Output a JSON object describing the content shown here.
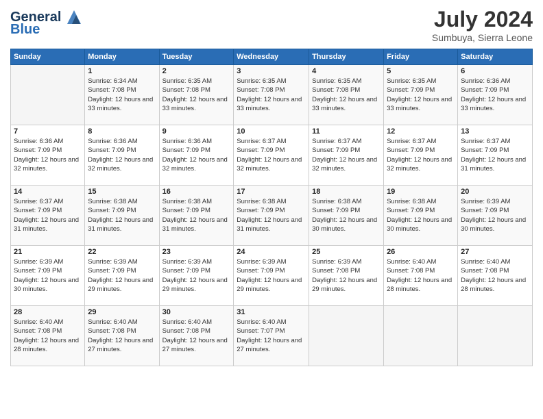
{
  "header": {
    "logo_general": "General",
    "logo_blue": "Blue",
    "month_year": "July 2024",
    "location": "Sumbuya, Sierra Leone"
  },
  "days_of_week": [
    "Sunday",
    "Monday",
    "Tuesday",
    "Wednesday",
    "Thursday",
    "Friday",
    "Saturday"
  ],
  "weeks": [
    [
      {
        "day": "",
        "info": ""
      },
      {
        "day": "1",
        "info": "Sunrise: 6:34 AM\nSunset: 7:08 PM\nDaylight: 12 hours\nand 33 minutes."
      },
      {
        "day": "2",
        "info": "Sunrise: 6:35 AM\nSunset: 7:08 PM\nDaylight: 12 hours\nand 33 minutes."
      },
      {
        "day": "3",
        "info": "Sunrise: 6:35 AM\nSunset: 7:08 PM\nDaylight: 12 hours\nand 33 minutes."
      },
      {
        "day": "4",
        "info": "Sunrise: 6:35 AM\nSunset: 7:08 PM\nDaylight: 12 hours\nand 33 minutes."
      },
      {
        "day": "5",
        "info": "Sunrise: 6:35 AM\nSunset: 7:09 PM\nDaylight: 12 hours\nand 33 minutes."
      },
      {
        "day": "6",
        "info": "Sunrise: 6:36 AM\nSunset: 7:09 PM\nDaylight: 12 hours\nand 33 minutes."
      }
    ],
    [
      {
        "day": "7",
        "info": ""
      },
      {
        "day": "8",
        "info": "Sunrise: 6:36 AM\nSunset: 7:09 PM\nDaylight: 12 hours\nand 32 minutes."
      },
      {
        "day": "9",
        "info": "Sunrise: 6:36 AM\nSunset: 7:09 PM\nDaylight: 12 hours\nand 32 minutes."
      },
      {
        "day": "10",
        "info": "Sunrise: 6:37 AM\nSunset: 7:09 PM\nDaylight: 12 hours\nand 32 minutes."
      },
      {
        "day": "11",
        "info": "Sunrise: 6:37 AM\nSunset: 7:09 PM\nDaylight: 12 hours\nand 32 minutes."
      },
      {
        "day": "12",
        "info": "Sunrise: 6:37 AM\nSunset: 7:09 PM\nDaylight: 12 hours\nand 32 minutes."
      },
      {
        "day": "13",
        "info": "Sunrise: 6:37 AM\nSunset: 7:09 PM\nDaylight: 12 hours\nand 31 minutes."
      }
    ],
    [
      {
        "day": "14",
        "info": ""
      },
      {
        "day": "15",
        "info": "Sunrise: 6:38 AM\nSunset: 7:09 PM\nDaylight: 12 hours\nand 31 minutes."
      },
      {
        "day": "16",
        "info": "Sunrise: 6:38 AM\nSunset: 7:09 PM\nDaylight: 12 hours\nand 31 minutes."
      },
      {
        "day": "17",
        "info": "Sunrise: 6:38 AM\nSunset: 7:09 PM\nDaylight: 12 hours\nand 31 minutes."
      },
      {
        "day": "18",
        "info": "Sunrise: 6:38 AM\nSunset: 7:09 PM\nDaylight: 12 hours\nand 30 minutes."
      },
      {
        "day": "19",
        "info": "Sunrise: 6:38 AM\nSunset: 7:09 PM\nDaylight: 12 hours\nand 30 minutes."
      },
      {
        "day": "20",
        "info": "Sunrise: 6:39 AM\nSunset: 7:09 PM\nDaylight: 12 hours\nand 30 minutes."
      }
    ],
    [
      {
        "day": "21",
        "info": ""
      },
      {
        "day": "22",
        "info": "Sunrise: 6:39 AM\nSunset: 7:09 PM\nDaylight: 12 hours\nand 29 minutes."
      },
      {
        "day": "23",
        "info": "Sunrise: 6:39 AM\nSunset: 7:09 PM\nDaylight: 12 hours\nand 29 minutes."
      },
      {
        "day": "24",
        "info": "Sunrise: 6:39 AM\nSunset: 7:09 PM\nDaylight: 12 hours\nand 29 minutes."
      },
      {
        "day": "25",
        "info": "Sunrise: 6:39 AM\nSunset: 7:08 PM\nDaylight: 12 hours\nand 29 minutes."
      },
      {
        "day": "26",
        "info": "Sunrise: 6:40 AM\nSunset: 7:08 PM\nDaylight: 12 hours\nand 28 minutes."
      },
      {
        "day": "27",
        "info": "Sunrise: 6:40 AM\nSunset: 7:08 PM\nDaylight: 12 hours\nand 28 minutes."
      }
    ],
    [
      {
        "day": "28",
        "info": "Sunrise: 6:40 AM\nSunset: 7:08 PM\nDaylight: 12 hours\nand 28 minutes."
      },
      {
        "day": "29",
        "info": "Sunrise: 6:40 AM\nSunset: 7:08 PM\nDaylight: 12 hours\nand 27 minutes."
      },
      {
        "day": "30",
        "info": "Sunrise: 6:40 AM\nSunset: 7:08 PM\nDaylight: 12 hours\nand 27 minutes."
      },
      {
        "day": "31",
        "info": "Sunrise: 6:40 AM\nSunset: 7:07 PM\nDaylight: 12 hours\nand 27 minutes."
      },
      {
        "day": "",
        "info": ""
      },
      {
        "day": "",
        "info": ""
      },
      {
        "day": "",
        "info": ""
      }
    ]
  ],
  "week7_sunday": {
    "day": "7",
    "info": "Sunrise: 6:36 AM\nSunset: 7:09 PM\nDaylight: 12 hours\nand 32 minutes."
  },
  "week14_sunday": {
    "day": "14",
    "info": "Sunrise: 6:37 AM\nSunset: 7:09 PM\nDaylight: 12 hours\nand 31 minutes."
  },
  "week21_sunday": {
    "day": "21",
    "info": "Sunrise: 6:39 AM\nSunset: 7:09 PM\nDaylight: 12 hours\nand 30 minutes."
  }
}
